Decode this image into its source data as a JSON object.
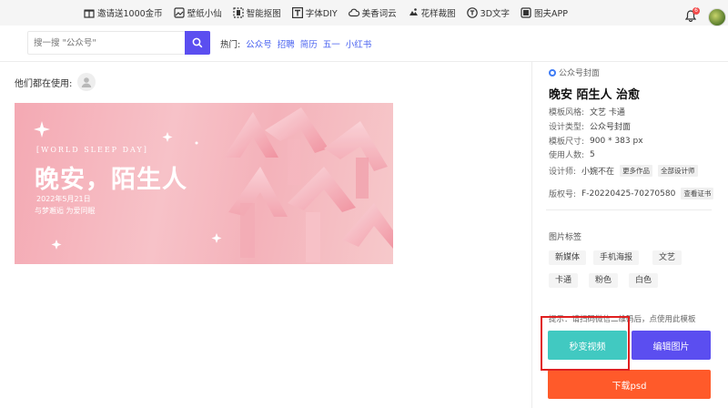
{
  "topbar": {
    "tools": [
      {
        "label": "邀请送1000金币",
        "icon": "gift-icon"
      },
      {
        "label": "壁纸小仙",
        "icon": "wallpaper-icon"
      },
      {
        "label": "智能抠图",
        "icon": "cutout-icon"
      },
      {
        "label": "字体DIY",
        "icon": "font-icon"
      },
      {
        "label": "美香词云",
        "icon": "cloud-icon"
      },
      {
        "label": "花样裁图",
        "icon": "crop-icon"
      },
      {
        "label": "3D文字",
        "icon": "text3d-icon"
      },
      {
        "label": "图夫APP",
        "icon": "app-icon"
      }
    ]
  },
  "search": {
    "placeholder": "搜一搜 \"公众号\""
  },
  "hot": {
    "label": "热门:",
    "keywords": [
      "公众号",
      "招聘",
      "简历",
      "五一",
      "小红书"
    ]
  },
  "notifications": {
    "badge": "6"
  },
  "users": {
    "label": "他们都在使用:"
  },
  "banner": {
    "subtitle": "[WORLD SLEEP DAY]",
    "headline": "晚安，陌生人",
    "date": "2022年5月21日",
    "slogan": "与梦邂逅 为爱同眠",
    "background": "#f4b2ba"
  },
  "panel": {
    "breadcrumb": "公众号封面",
    "title": "晚安 陌生人 治愈",
    "meta": {
      "style_label": "模板风格:",
      "style_value": "文艺 卡通",
      "type_label": "设计类型:",
      "type_value": "公众号封面",
      "size_label": "模板尺寸:",
      "size_value": "900 * 383 px",
      "users_label": "使用人数:",
      "users_value": "5",
      "designer_label": "设计师:",
      "designer_value": "小婉不在",
      "more_works": "更多作品",
      "all_certs": "全部设计师",
      "copyright_label": "版权号:",
      "copyright_value": "F-20220425-70270580",
      "view_cert": "查看证书"
    },
    "tags_label": "图片标签",
    "tags": [
      "新媒体",
      "手机海报",
      "文艺",
      "卡通",
      "粉色",
      "白色"
    ],
    "tip": "提示：请扫码微信二维码后，点使用此模板",
    "buttons": {
      "video": "秒变视频",
      "edit": "编辑图片",
      "download": "下载psd"
    },
    "colors": {
      "video": "#41c9c1",
      "edit": "#5b4ef0",
      "download": "#ff5a2a",
      "highlight": "#e02020"
    }
  }
}
